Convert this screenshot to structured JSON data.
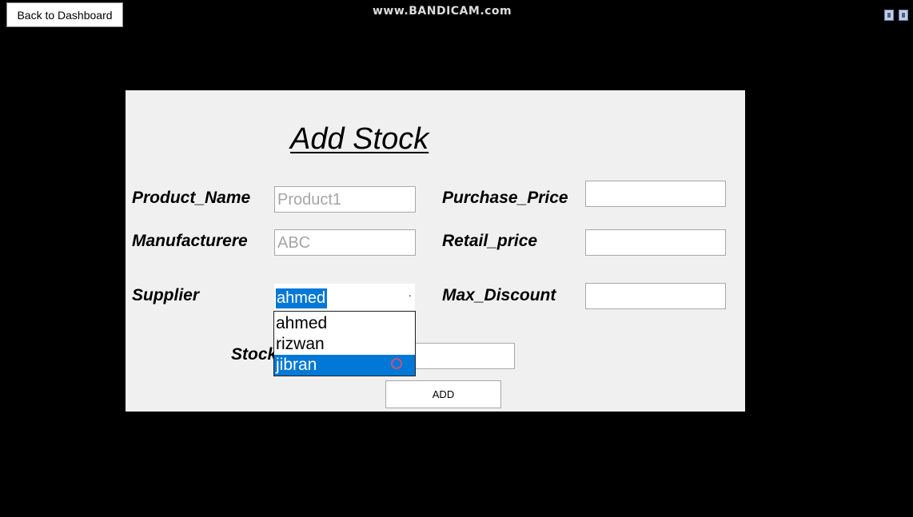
{
  "header": {
    "back_label": "Back to Dashboard",
    "watermark": "www.BANDICAM.com"
  },
  "form": {
    "title": "Add Stock",
    "product_name": {
      "label": "Product_Name",
      "value": "Product1"
    },
    "manufacturer": {
      "label": "Manufacturere",
      "value": "ABC"
    },
    "supplier": {
      "label": "Supplier",
      "value": "ahmed",
      "options": [
        "ahmed",
        "rizwan",
        "jibran"
      ],
      "highlighted_option": "jibran"
    },
    "stock": {
      "label": "Stock",
      "value": ""
    },
    "purchase_price": {
      "label": "Purchase_Price",
      "value": ""
    },
    "retail_price": {
      "label": "Retail_price",
      "value": ""
    },
    "max_discount": {
      "label": "Max_Discount",
      "value": ""
    },
    "add_label": "ADD"
  },
  "colors": {
    "selection": "#0078d7",
    "panel": "#f0f0f0",
    "background": "#000000"
  }
}
